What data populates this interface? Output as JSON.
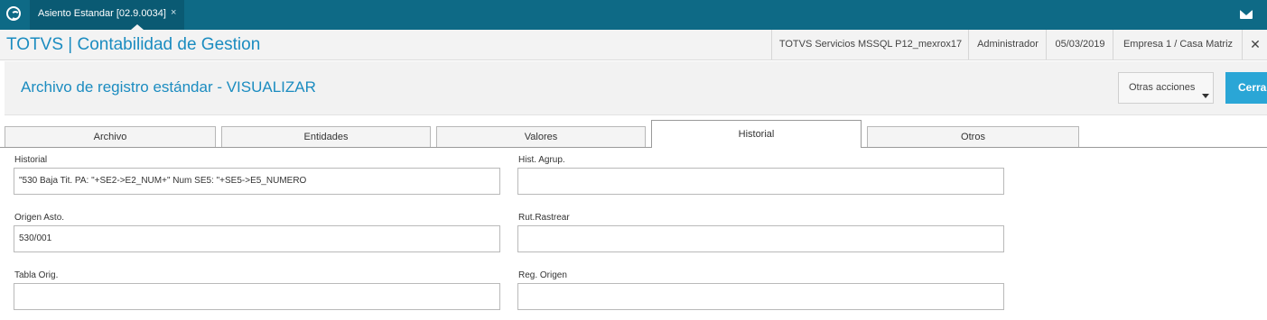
{
  "topbar": {
    "tab_label": "Asiento Estandar [02.9.0034]",
    "tab_close": "×",
    "logo_icon": "totvs-logo-icon",
    "mail_icon": "mail-icon",
    "color": "#0e6a86"
  },
  "titlebar": {
    "app_title": "TOTVS | Contabilidad de Gestion",
    "server": "TOTVS Servicios MSSQL P12_mexrox17",
    "user": "Administrador",
    "date": "05/03/2019",
    "company": "Empresa 1 / Casa Matriz",
    "close": "✕"
  },
  "header": {
    "title": "Archivo de registro estándar - VISUALIZAR",
    "otras_acciones": "Otras acciones",
    "cerrar": "Cerra"
  },
  "tabs": [
    {
      "label": "Archivo"
    },
    {
      "label": "Entidades"
    },
    {
      "label": "Valores"
    },
    {
      "label": "Historial"
    },
    {
      "label": "Otros"
    }
  ],
  "active_tab": "Historial",
  "form": {
    "historial": {
      "label": "Historial",
      "value": "\"530 Baja Tit. PA: \"+SE2->E2_NUM+\" Num SE5: \"+SE5->E5_NUMERO"
    },
    "hist_agrup": {
      "label": "Hist. Agrup.",
      "value": ""
    },
    "origen_asto": {
      "label": "Origen Asto.",
      "value": "530/001"
    },
    "rut_rastrear": {
      "label": "Rut.Rastrear",
      "value": ""
    },
    "tabla_orig": {
      "label": "Tabla Orig.",
      "value": ""
    },
    "reg_origen": {
      "label": "Reg. Origen",
      "value": ""
    }
  },
  "colors": {
    "accent": "#1b8cc0",
    "button_primary": "#2aa6d6"
  }
}
